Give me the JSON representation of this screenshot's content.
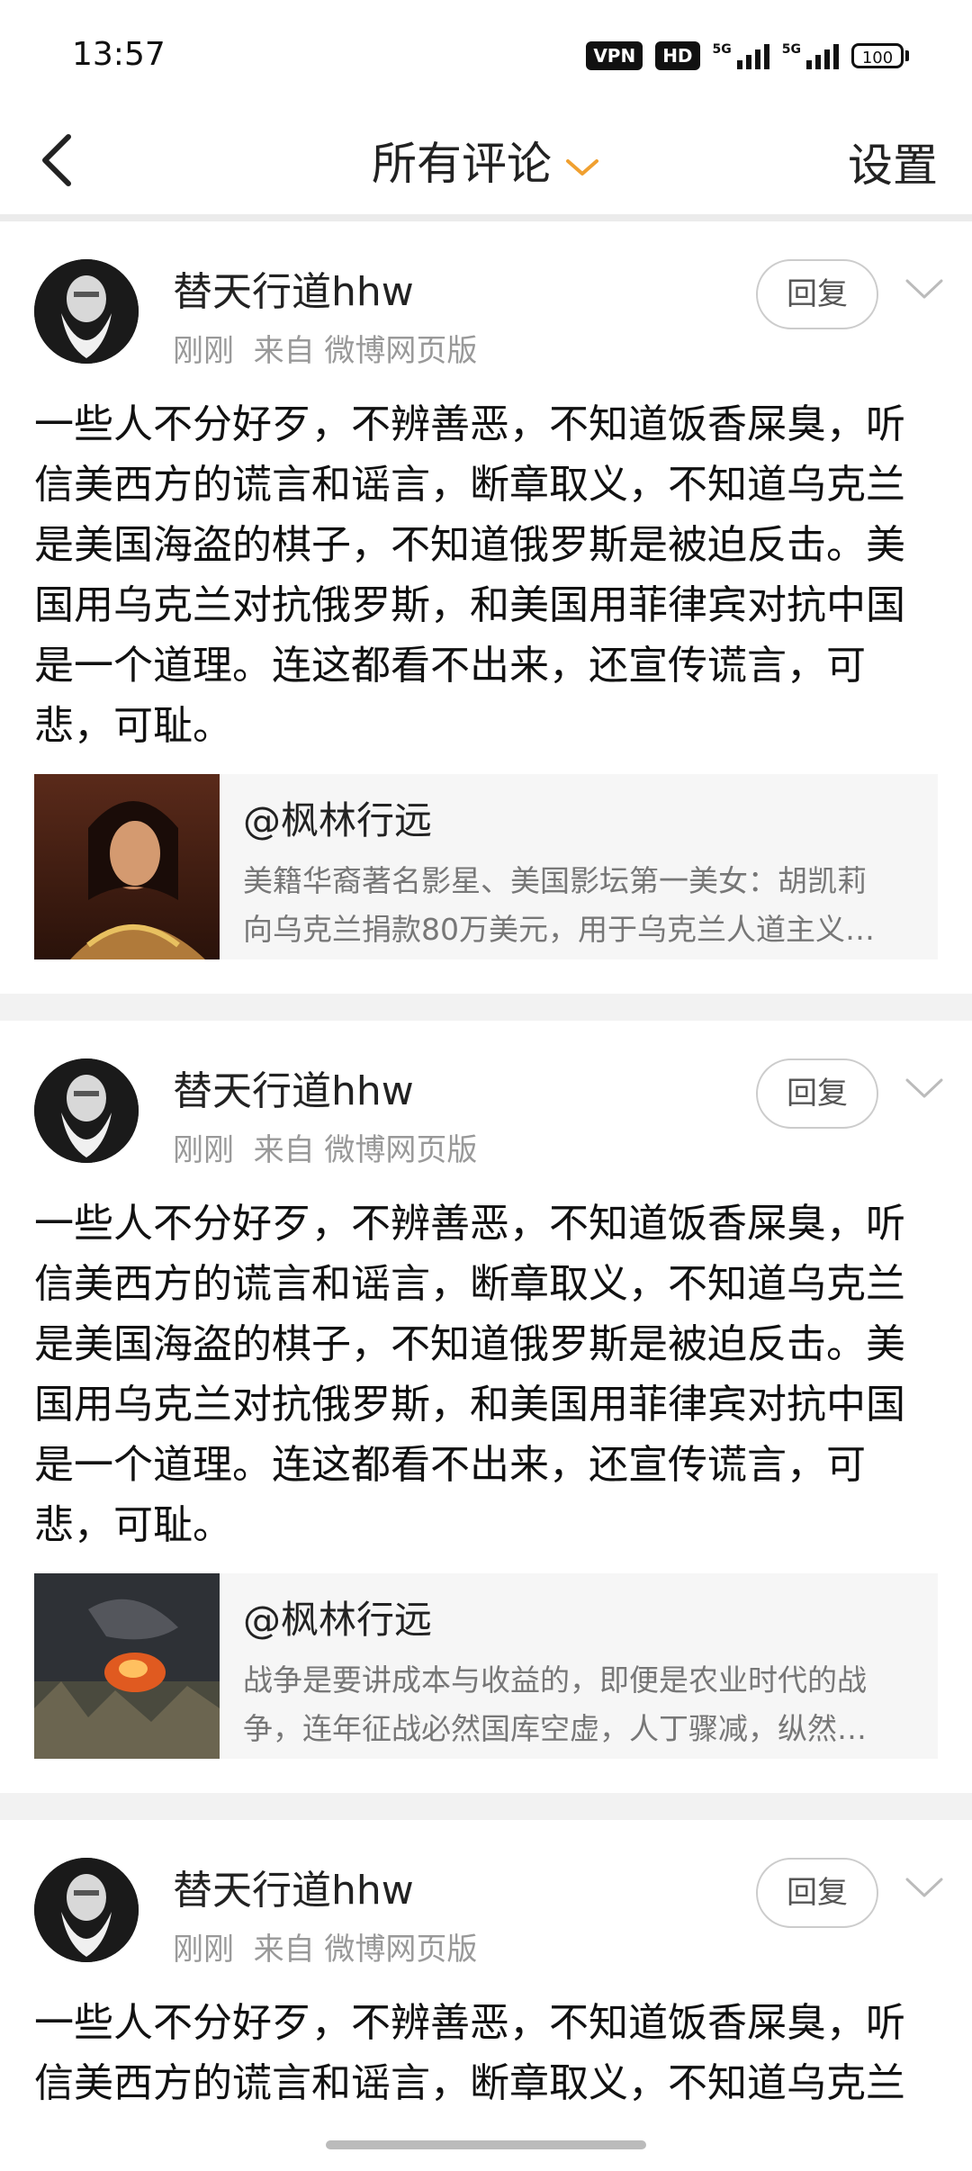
{
  "status_bar": {
    "time": "13:57",
    "vpn": "VPN",
    "hd": "HD",
    "signal1": "5G",
    "signal2": "5G",
    "battery": "100"
  },
  "nav": {
    "title": "所有评论",
    "settings": "设置"
  },
  "comments": [
    {
      "username": "替天行道hhw",
      "time": "刚刚",
      "source": "来自 微博网页版",
      "reply_label": "回复",
      "text": "一些人不分好歹，不辨善恶，不知道饭香屎臭，听\n信美西方的谎言和谣言，断章取义，不知道乌克兰\n是美国海盗的棋子，不知道俄罗斯是被迫反击。美\n国用乌克兰对抗俄罗斯，和美国用菲律宾对抗中国\n是一个道理。连这都看不出来，还宣传谎言，可\n悲，可耻。",
      "quote": {
        "author": "@枫林行远",
        "line1": "美籍华裔著名影星、美国影坛第一美女：胡凯莉",
        "line2": "向乌克兰捐款80万美元，用于乌克兰人道主义…"
      }
    },
    {
      "username": "替天行道hhw",
      "time": "刚刚",
      "source": "来自 微博网页版",
      "reply_label": "回复",
      "text": "一些人不分好歹，不辨善恶，不知道饭香屎臭，听\n信美西方的谎言和谣言，断章取义，不知道乌克兰\n是美国海盗的棋子，不知道俄罗斯是被迫反击。美\n国用乌克兰对抗俄罗斯，和美国用菲律宾对抗中国\n是一个道理。连这都看不出来，还宣传谎言，可\n悲，可耻。",
      "quote": {
        "author": "@枫林行远",
        "line1": "战争是要讲成本与收益的，即便是农业时代的战",
        "line2": "争，连年征战必然国库空虚，人丁骤减，纵然…"
      }
    },
    {
      "username": "替天行道hhw",
      "time": "刚刚",
      "source": "来自 微博网页版",
      "reply_label": "回复",
      "text": "一些人不分好歹，不辨善恶，不知道饭香屎臭，听\n信美西方的谎言和谣言，断章取义，不知道乌克兰"
    }
  ]
}
